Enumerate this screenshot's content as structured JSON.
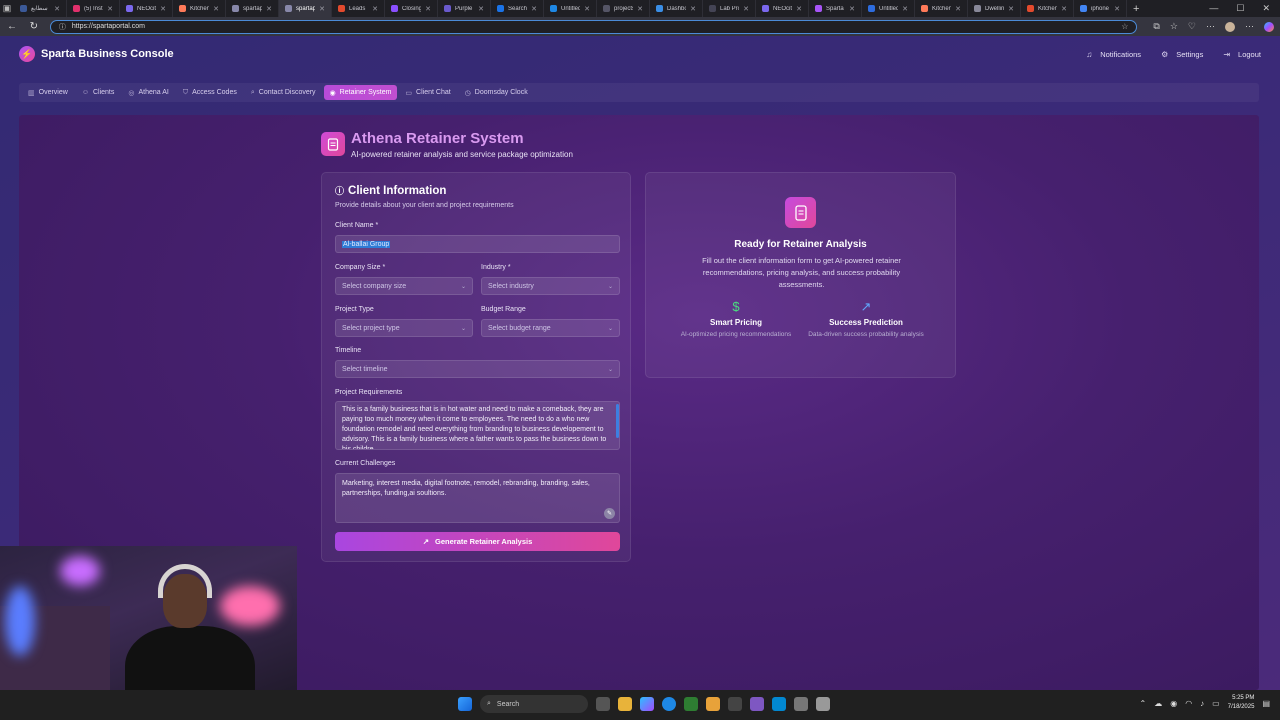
{
  "browser": {
    "tabs": [
      {
        "title": "سطابع",
        "color": "#3b5998"
      },
      {
        "title": "(5) Instu",
        "color": "#e1306c"
      },
      {
        "title": "NEOcity",
        "color": "#7b68ee"
      },
      {
        "title": "Kitchen",
        "color": "#ff7a59"
      },
      {
        "title": "spartape",
        "color": "#8888aa"
      },
      {
        "title": "spartapo",
        "color": "#8888aa"
      },
      {
        "title": "Leads",
        "color": "#e34a2d"
      },
      {
        "title": "Closing",
        "color": "#8a4fff"
      },
      {
        "title": "Purple",
        "color": "#6a5acd"
      },
      {
        "title": "Search",
        "color": "#1a73e8"
      },
      {
        "title": "Untitled",
        "color": "#1e88e5"
      },
      {
        "title": "projects",
        "color": "#555566"
      },
      {
        "title": "Dashbo",
        "color": "#3a8ee6"
      },
      {
        "title": "Lab Proj",
        "color": "#444455"
      },
      {
        "title": "NEOcity",
        "color": "#7b68ee"
      },
      {
        "title": "Sparta",
        "color": "#a855f7"
      },
      {
        "title": "Untitled",
        "color": "#2d6cdf"
      },
      {
        "title": "Kitchen",
        "color": "#ff7a59"
      },
      {
        "title": "Dwelling",
        "color": "#888899"
      },
      {
        "title": "Kitchen",
        "color": "#e34a2d"
      },
      {
        "title": "iphone",
        "color": "#4285f4"
      }
    ],
    "active_tab_index": 5,
    "url": "https://spartaportal.com"
  },
  "app": {
    "brand": "Sparta Business Console",
    "header_actions": [
      {
        "label": "Notifications",
        "icon": "bell-icon",
        "glyph": "♫"
      },
      {
        "label": "Settings",
        "icon": "gear-icon",
        "glyph": "⚙"
      },
      {
        "label": "Logout",
        "icon": "logout-icon",
        "glyph": "⇥"
      }
    ],
    "nav": [
      {
        "label": "Overview",
        "icon": "chart-icon",
        "glyph": "▥",
        "active": false
      },
      {
        "label": "Clients",
        "icon": "users-icon",
        "glyph": "☺",
        "active": false
      },
      {
        "label": "Athena AI",
        "icon": "brain-icon",
        "glyph": "◎",
        "active": false
      },
      {
        "label": "Access Codes",
        "icon": "shield-icon",
        "glyph": "⛉",
        "active": false
      },
      {
        "label": "Contact Discovery",
        "icon": "search-icon",
        "glyph": "⌕",
        "active": false
      },
      {
        "label": "Retainer System",
        "icon": "target-icon",
        "glyph": "◉",
        "active": true
      },
      {
        "label": "Client Chat",
        "icon": "chat-icon",
        "glyph": "▭",
        "active": false
      },
      {
        "label": "Doomsday Clock",
        "icon": "clock-icon",
        "glyph": "◷",
        "active": false
      }
    ]
  },
  "page": {
    "title": "Athena Retainer System",
    "subtitle": "AI-powered retainer analysis and service package optimization"
  },
  "form": {
    "title": "Client Information",
    "subtitle": "Provide details about your client and project requirements",
    "client_name_label": "Client Name *",
    "client_name_value": "Al-ballai Group",
    "company_size_label": "Company Size *",
    "company_size_placeholder": "Select company size",
    "industry_label": "Industry *",
    "industry_placeholder": "Select industry",
    "project_type_label": "Project Type",
    "project_type_placeholder": "Select project type",
    "budget_range_label": "Budget Range",
    "budget_range_placeholder": "Select budget range",
    "timeline_label": "Timeline",
    "timeline_placeholder": "Select timeline",
    "requirements_label": "Project Requirements",
    "requirements_value": "This is  a family business that is in hot water and need to make a comeback, they are paying too much money when it come to employees. The need to do a who new foundation remodel and need everything from branding to business developement to advisory. This is a family business where a father wants to pass the business down to his childre.",
    "challenges_label": "Current Challenges",
    "challenges_value": "Marketing, interest media, digital footnote, remodel, rebranding, branding, sales, partnerships, funding,ai soultions.",
    "generate_button": "Generate Retainer Analysis"
  },
  "info": {
    "title": "Ready for Retainer Analysis",
    "description": "Fill out the client information form to get AI-powered retainer recommendations, pricing analysis, and success probability assessments.",
    "features": [
      {
        "name": "Smart Pricing",
        "desc": "AI-optimized pricing recommendations",
        "icon": "dollar-icon",
        "glyph": "$",
        "color": "#4ade80"
      },
      {
        "name": "Success Prediction",
        "desc": "Data-driven success probability analysis",
        "icon": "trending-up-icon",
        "glyph": "↗",
        "color": "#60a5fa"
      }
    ]
  },
  "taskbar": {
    "search_label": "Search",
    "time": "5:25 PM",
    "date": "7/18/2025"
  }
}
